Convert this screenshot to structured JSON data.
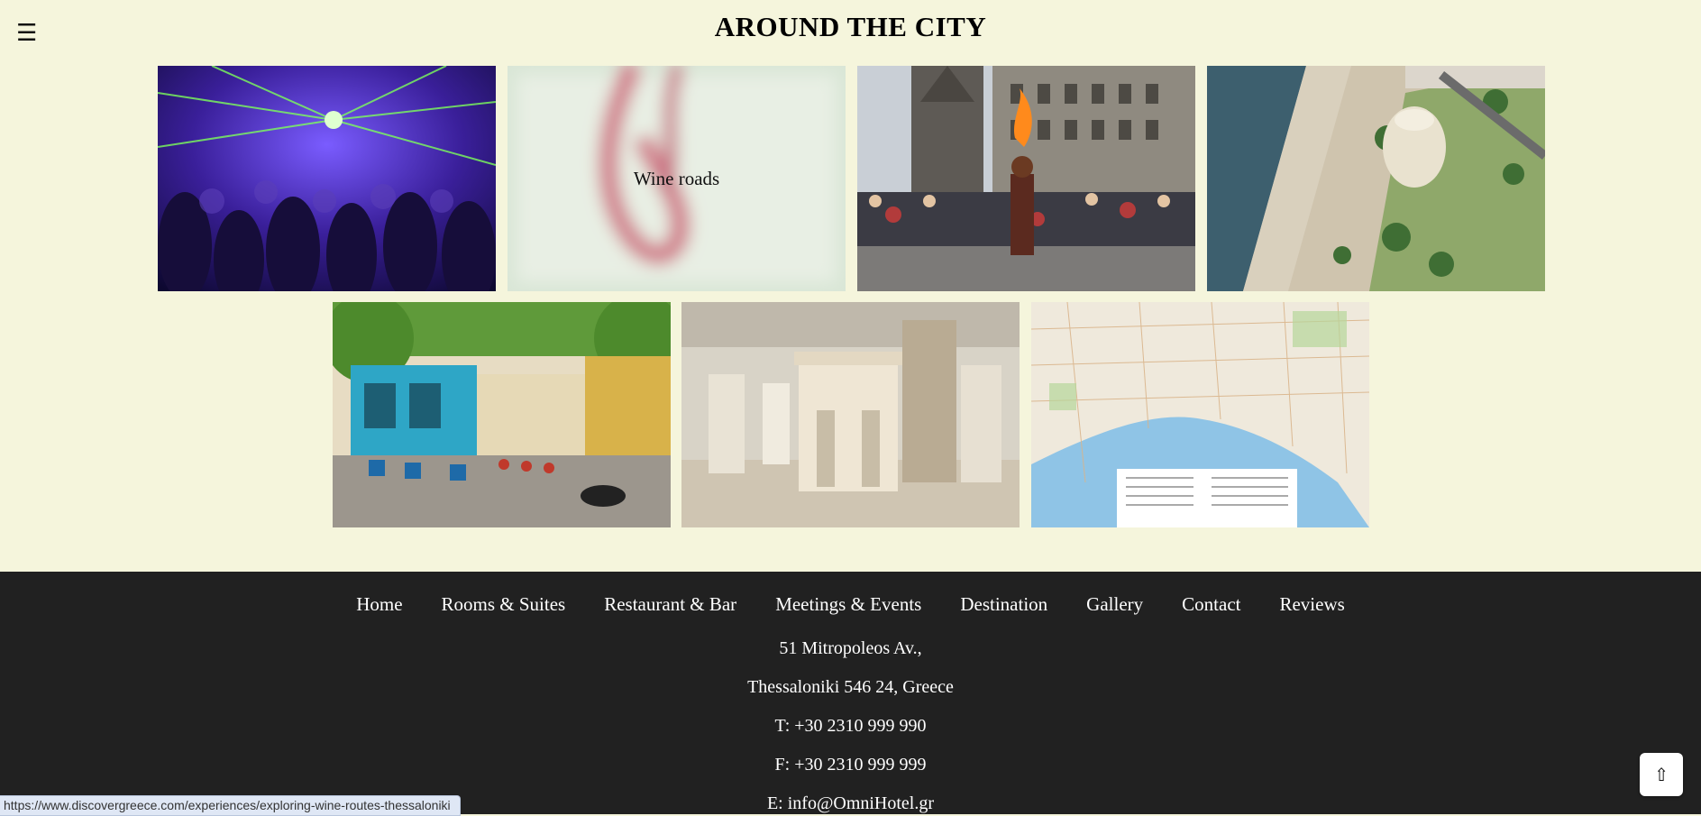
{
  "menu": {
    "icon": "hamburger-menu-icon",
    "glyph": "☰"
  },
  "page": {
    "title": "AROUND THE CITY"
  },
  "tiles": [
    {
      "image": "nightclub-crowd-lasers-image",
      "label": ""
    },
    {
      "image": "wine-roads-blurred-image",
      "label": "Wine roads"
    },
    {
      "image": "street-performer-fire-image",
      "label": ""
    },
    {
      "image": "white-tower-aerial-image",
      "label": ""
    },
    {
      "image": "old-town-cafes-street-image",
      "label": ""
    },
    {
      "image": "museum-hall-monuments-image",
      "label": ""
    },
    {
      "image": "city-map-image",
      "label": ""
    }
  ],
  "footer": {
    "nav": [
      "Home",
      "Rooms & Suites",
      "Restaurant & Bar",
      "Meetings & Events",
      "Destination",
      "Gallery",
      "Contact",
      "Reviews"
    ],
    "address_line1": "51 Mitropoleos Av.,",
    "address_line2": "Thessaloniki 546 24, Greece",
    "phone": "T: +30 2310 999 990",
    "fax": "F: +30 2310 999 999",
    "email": "E: info@OmniHotel.gr"
  },
  "status_bar": {
    "url": "https://www.discovergreece.com/experiences/exploring-wine-routes-thessaloniki"
  },
  "scroll_top": {
    "icon": "arrow-up-icon",
    "glyph": "⇧"
  },
  "colors": {
    "background": "#f5f5dc",
    "footer": "#212121"
  }
}
